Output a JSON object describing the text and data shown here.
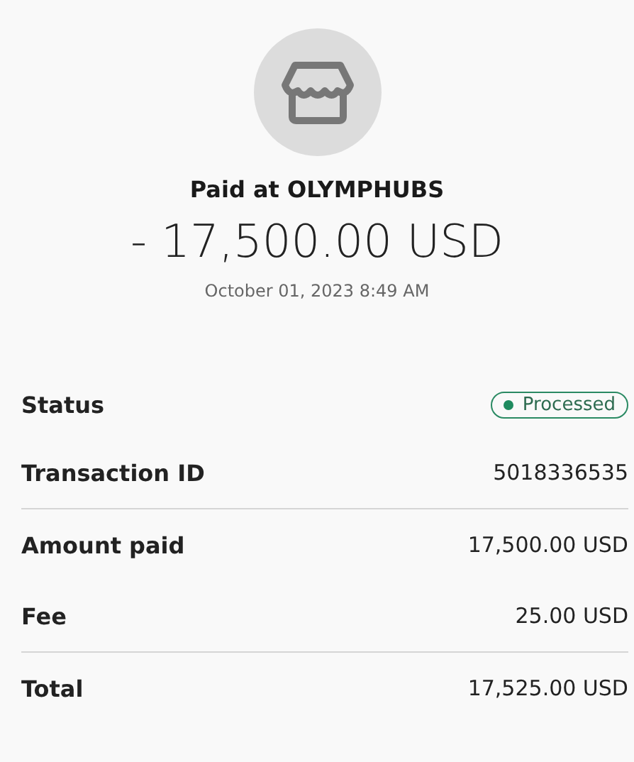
{
  "merchant": {
    "title": "Paid at OLYMPHUBS"
  },
  "amount": "- 17,500.00 USD",
  "date": "October 01, 2023 8:49 AM",
  "sections": [
    {
      "rows": [
        {
          "kind": "status",
          "label": "Status",
          "value": "Processed"
        },
        {
          "kind": "text",
          "label": "Transaction ID",
          "value": "5018336535"
        }
      ]
    },
    {
      "rows": [
        {
          "kind": "text",
          "label": "Amount paid",
          "value": "17,500.00 USD"
        },
        {
          "kind": "text",
          "label": "Fee",
          "value": "25.00 USD"
        }
      ]
    },
    {
      "rows": [
        {
          "kind": "text",
          "label": "Total",
          "value": "17,525.00 USD"
        }
      ]
    }
  ]
}
